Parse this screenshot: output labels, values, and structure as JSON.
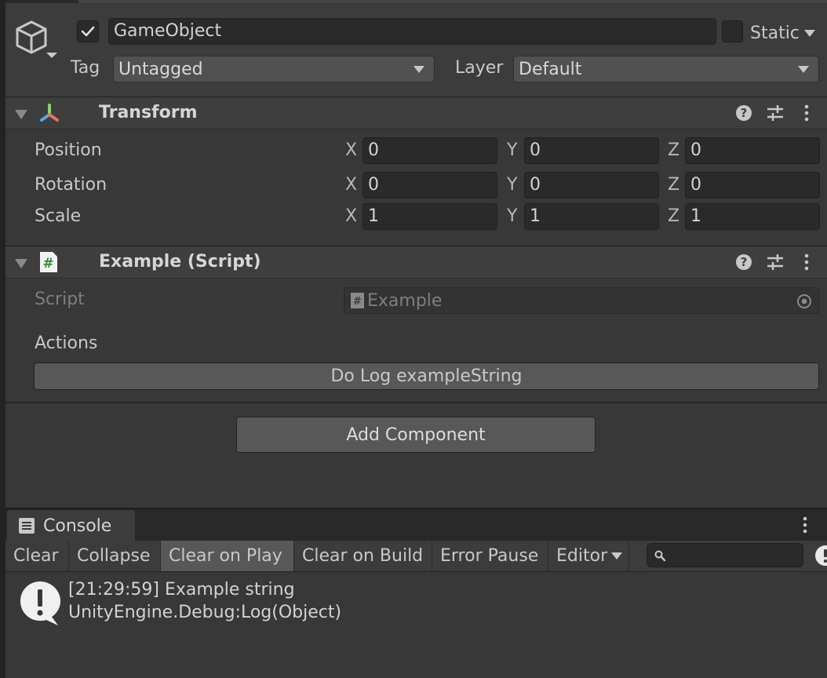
{
  "header": {
    "active": true,
    "name": "GameObject",
    "static_label": "Static",
    "static_checked": false,
    "tag_label": "Tag",
    "tag_value": "Untagged",
    "layer_label": "Layer",
    "layer_value": "Default"
  },
  "transform": {
    "title": "Transform",
    "rows": [
      {
        "label": "Position",
        "x": "0",
        "y": "0",
        "z": "0"
      },
      {
        "label": "Rotation",
        "x": "0",
        "y": "0",
        "z": "0"
      },
      {
        "label": "Scale",
        "x": "1",
        "y": "1",
        "z": "1"
      }
    ],
    "axis": {
      "x": "X",
      "y": "Y",
      "z": "Z"
    }
  },
  "script_component": {
    "title": "Example (Script)",
    "script_label": "Script",
    "script_value": "Example",
    "actions_label": "Actions",
    "action_button": "Do Log exampleString"
  },
  "add_component": "Add Component",
  "console": {
    "tab_label": "Console",
    "toolbar": {
      "clear": "Clear",
      "collapse": "Collapse",
      "clear_on_play": "Clear on Play",
      "clear_on_build": "Clear on Build",
      "error_pause": "Error Pause",
      "editor": "Editor"
    },
    "search_placeholder": "",
    "entries": [
      {
        "line1": "[21:29:59] Example string",
        "line2": "UnityEngine.Debug:Log(Object)"
      }
    ]
  },
  "icons": {
    "gameobject": "cube-icon",
    "transform": "transform-axes-icon",
    "script": "cs-script-icon",
    "help": "help-icon",
    "presets": "sliders-icon",
    "menu": "kebab-menu-icon",
    "log": "info-log-icon"
  }
}
